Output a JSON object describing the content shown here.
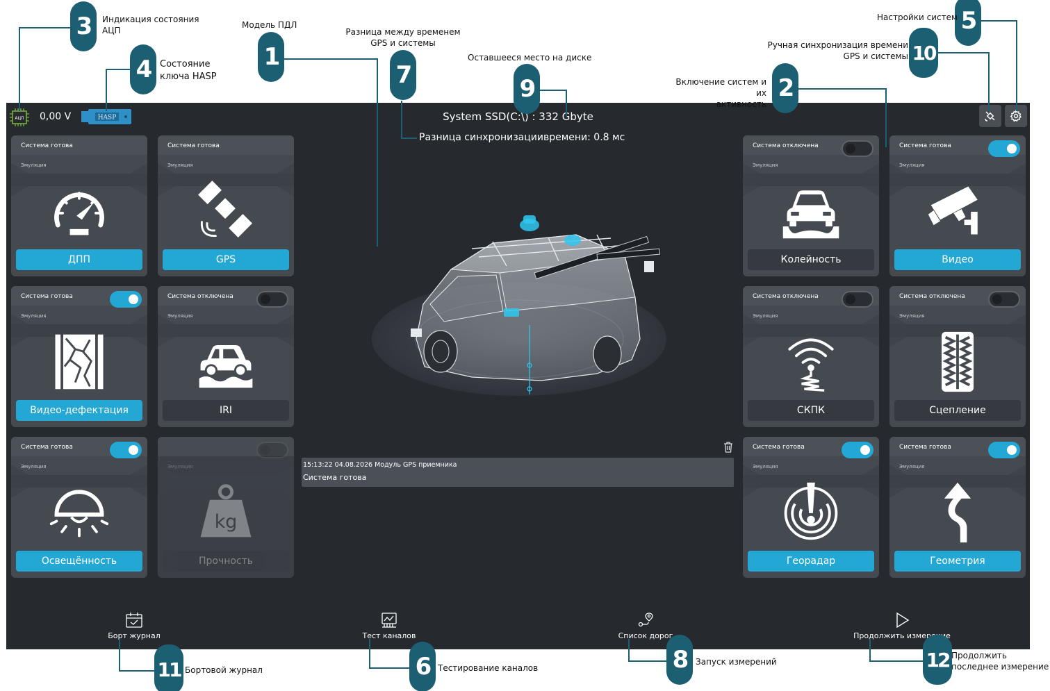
{
  "topbar": {
    "adc_chip_label": "АЦП",
    "voltage": "0,00  V",
    "hasp_label": "HASP",
    "ssd": "System SSD(C:\\) : 332 Gbyte",
    "time_diff": "Разница синхронизациивремени: 0.8 мс"
  },
  "tiles": [
    {
      "id": "dpp",
      "status": "Система готова",
      "emu": "Эмуляция",
      "label": "ДПП",
      "toggle": "none",
      "active": true,
      "icon": "speedometer-icon"
    },
    {
      "id": "gps",
      "status": "Система готова",
      "emu": "Эмуляция",
      "label": "GPS",
      "toggle": "none",
      "active": true,
      "icon": "satellite-icon"
    },
    {
      "id": "video-defect",
      "status": "Система готова",
      "emu": "Эмуляция",
      "label": "Видео-дефектация",
      "toggle": "on",
      "active": true,
      "icon": "cracked-road-icon"
    },
    {
      "id": "iri",
      "status": "Система отключена",
      "emu": "Эмуляция",
      "label": "IRI",
      "toggle": "off",
      "active": false,
      "icon": "car-bumps-icon"
    },
    {
      "id": "light",
      "status": "Система готова",
      "emu": "Эмуляция",
      "label": "Освещённость",
      "toggle": "on",
      "active": true,
      "icon": "lamp-icon"
    },
    {
      "id": "strength",
      "status": "",
      "emu": "Эмуляция",
      "label": "Прочность",
      "toggle": "off",
      "active": false,
      "icon": "weight-icon"
    },
    {
      "id": "rut",
      "status": "Система отключена",
      "emu": "Эмуляция",
      "label": "Колейность",
      "toggle": "off",
      "active": false,
      "icon": "car-rut-icon"
    },
    {
      "id": "video",
      "status": "Система готова",
      "emu": "Эмуляция",
      "label": "Видео",
      "toggle": "on",
      "active": true,
      "icon": "cctv-camera-icon"
    },
    {
      "id": "skpk",
      "status": "Система отключена",
      "emu": "Эмуляция",
      "label": "СКПК",
      "toggle": "off",
      "active": false,
      "icon": "wireless-sensor-icon"
    },
    {
      "id": "grip",
      "status": "Система отключена",
      "emu": "Эмуляция",
      "label": "Сцепление",
      "toggle": "off",
      "active": false,
      "icon": "tire-tread-icon"
    },
    {
      "id": "georadar",
      "status": "Система готова",
      "emu": "Эмуляция",
      "label": "Георадар",
      "toggle": "on",
      "active": true,
      "icon": "radar-icon"
    },
    {
      "id": "geometry",
      "status": "Система готова",
      "emu": "Эмуляция",
      "label": "Геометрия",
      "toggle": "on",
      "active": true,
      "icon": "winding-road-icon"
    }
  ],
  "log": {
    "line1": "15:13:22 04.08.2026  Модуль GPS приемника",
    "line2": "Система готова"
  },
  "nav": {
    "journal": "Борт журнал",
    "test": "Тест каналов",
    "roads": "Список дорог",
    "continue": "Продолжить измерение"
  },
  "annotations": {
    "a1": "Модель ПДЛ",
    "a2": "Включение систем и их\nактивность",
    "a3": "Индикация состояния\nАЦП",
    "a4": "Состояние\nключа HASP",
    "a5": "Настройки систем",
    "a6": "Тестирование каналов",
    "a7": "Разница между временем\nGPS и системы",
    "a8": "Запуск измерений",
    "a9": "Оставшееся место на диске",
    "a10": "Ручная синхронизация времени\nGPS и системы",
    "a11": "Бортовой журнал",
    "a12": "Продолжить\nпоследнее измерение"
  },
  "callouts": [
    "1",
    "2",
    "3",
    "4",
    "5",
    "6",
    "7",
    "8",
    "9",
    "10",
    "11",
    "12"
  ],
  "colors": {
    "accent": "#23a8d6",
    "app_bg": "#262a2f",
    "tile_bg": "#454a51",
    "callout": "#1d5f72"
  }
}
